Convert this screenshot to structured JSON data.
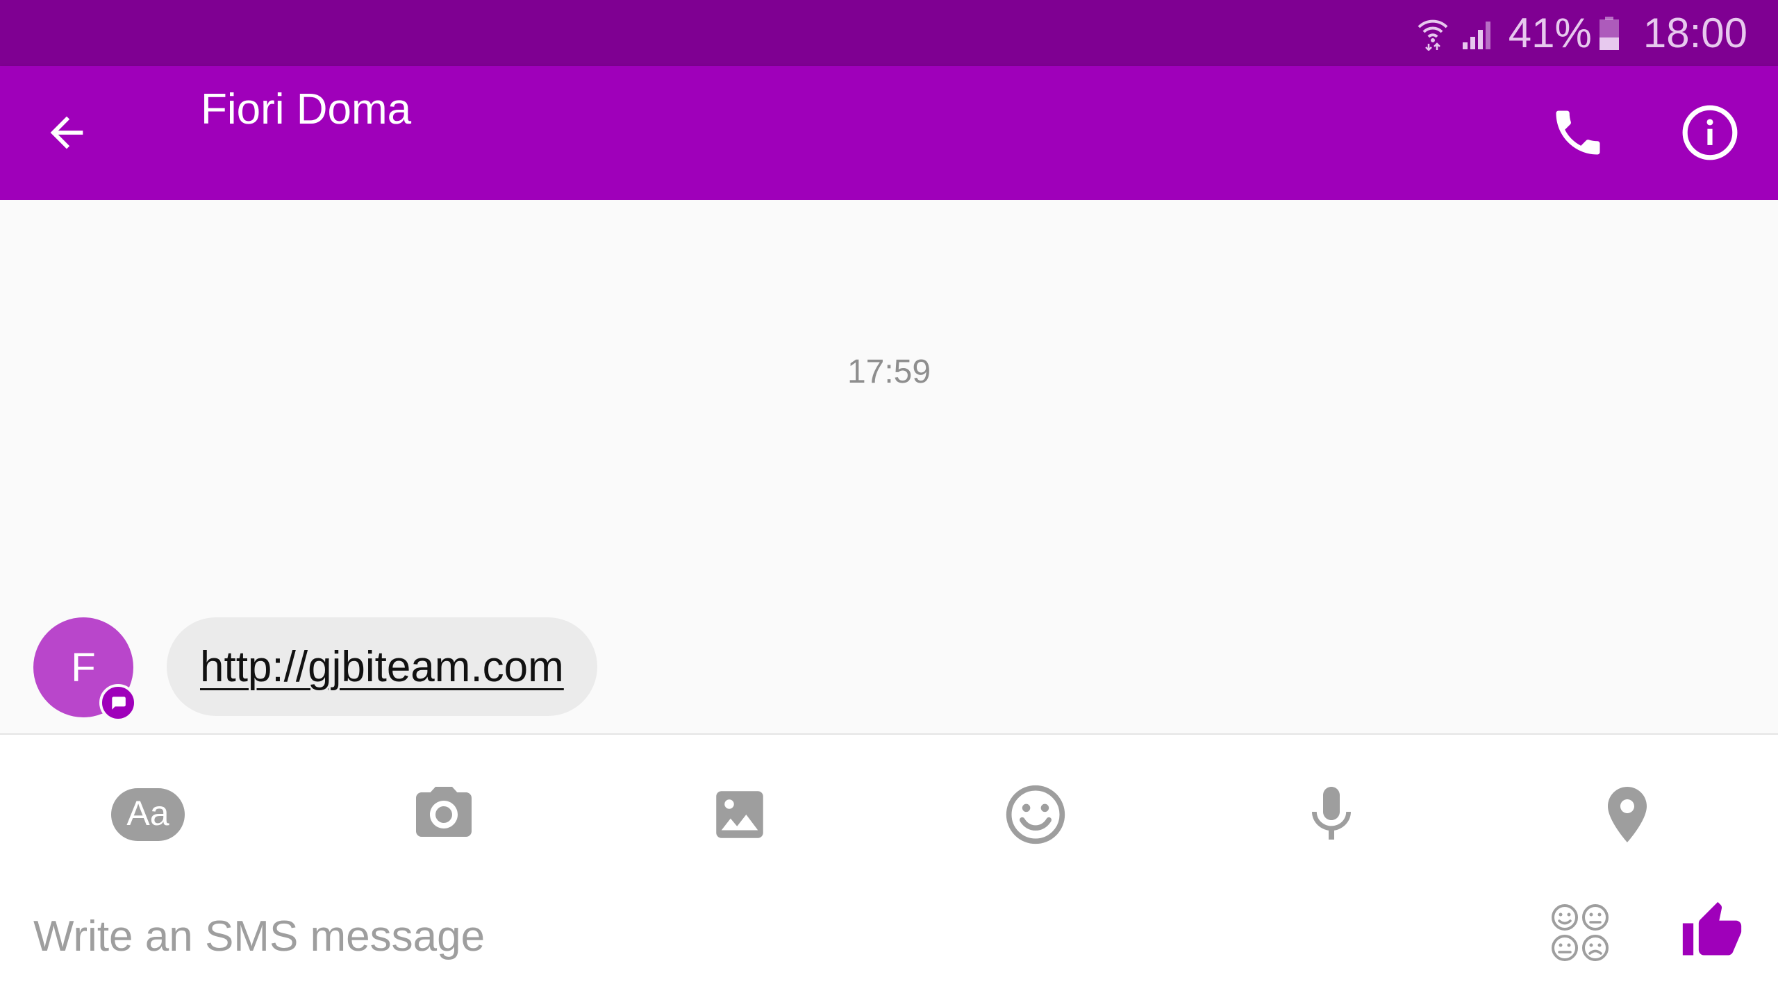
{
  "status_bar": {
    "battery_percent": "41%",
    "battery_level": 0.41,
    "time": "18:00",
    "icons": [
      "wifi-icon",
      "signal-icon",
      "battery-icon"
    ]
  },
  "header": {
    "title": "Fiori Doma",
    "icons": [
      "back-arrow-icon",
      "phone-icon",
      "info-icon"
    ]
  },
  "conversation": {
    "timestamp": "17:59",
    "messages": [
      {
        "sender_initial": "F",
        "text": "http://gjbiteam.com"
      }
    ]
  },
  "composer": {
    "tools": [
      "text-format-icon",
      "camera-icon",
      "gallery-icon",
      "emoji-icon",
      "microphone-icon",
      "location-icon"
    ],
    "text_format_label": "Aa",
    "placeholder": "Write an SMS message",
    "value": ""
  },
  "colors": {
    "status_bar": "#7f0092",
    "toolbar": "#9f00ba",
    "avatar": "#b946cb",
    "accent": "#9f00ba",
    "icon_gray": "#9e9e9e",
    "bubble": "#ebebeb"
  }
}
